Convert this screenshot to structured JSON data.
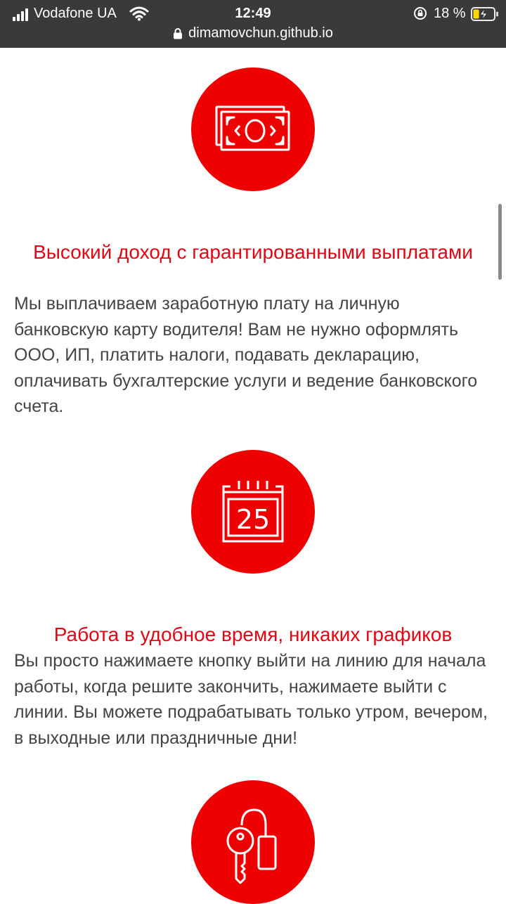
{
  "status_bar": {
    "carrier": "Vodafone UA",
    "time": "12:49",
    "battery_percent": "18 %",
    "battery_level": 0.18,
    "icons": [
      "signal-icon",
      "wifi-icon",
      "rotation-lock-icon",
      "battery-charging-icon"
    ]
  },
  "browser": {
    "url": "dimamovchun.github.io",
    "icons": [
      "lock-icon"
    ]
  },
  "features": [
    {
      "icon": "money-icon",
      "title": "Высокий доход с гарантированными выплатами",
      "description": "Мы выплачиваем заработную плату на личную банковскую карту водителя! Вам не нужно оформлять ООО, ИП, платить налоги, подавать декларацию, оплачивать бухгалтерские услуги и ведение банковского счета."
    },
    {
      "icon": "calendar-icon",
      "calendar_day": "25",
      "title": "Работа в удобное время, никаких графиков",
      "description": "Вы просто нажимаете кнопку выйти на линию для начала работы, когда решите закончить, нажимаете выйти с линии. Вы можете подрабатывать только утром, вечером, в выходные или праздничные дни!"
    },
    {
      "icon": "car-key-icon"
    }
  ],
  "colors": {
    "accent": "#ee0000",
    "title": "#e30613",
    "text": "#444444",
    "status_bar": "#3a3a3c",
    "battery": "#ffd60a"
  }
}
